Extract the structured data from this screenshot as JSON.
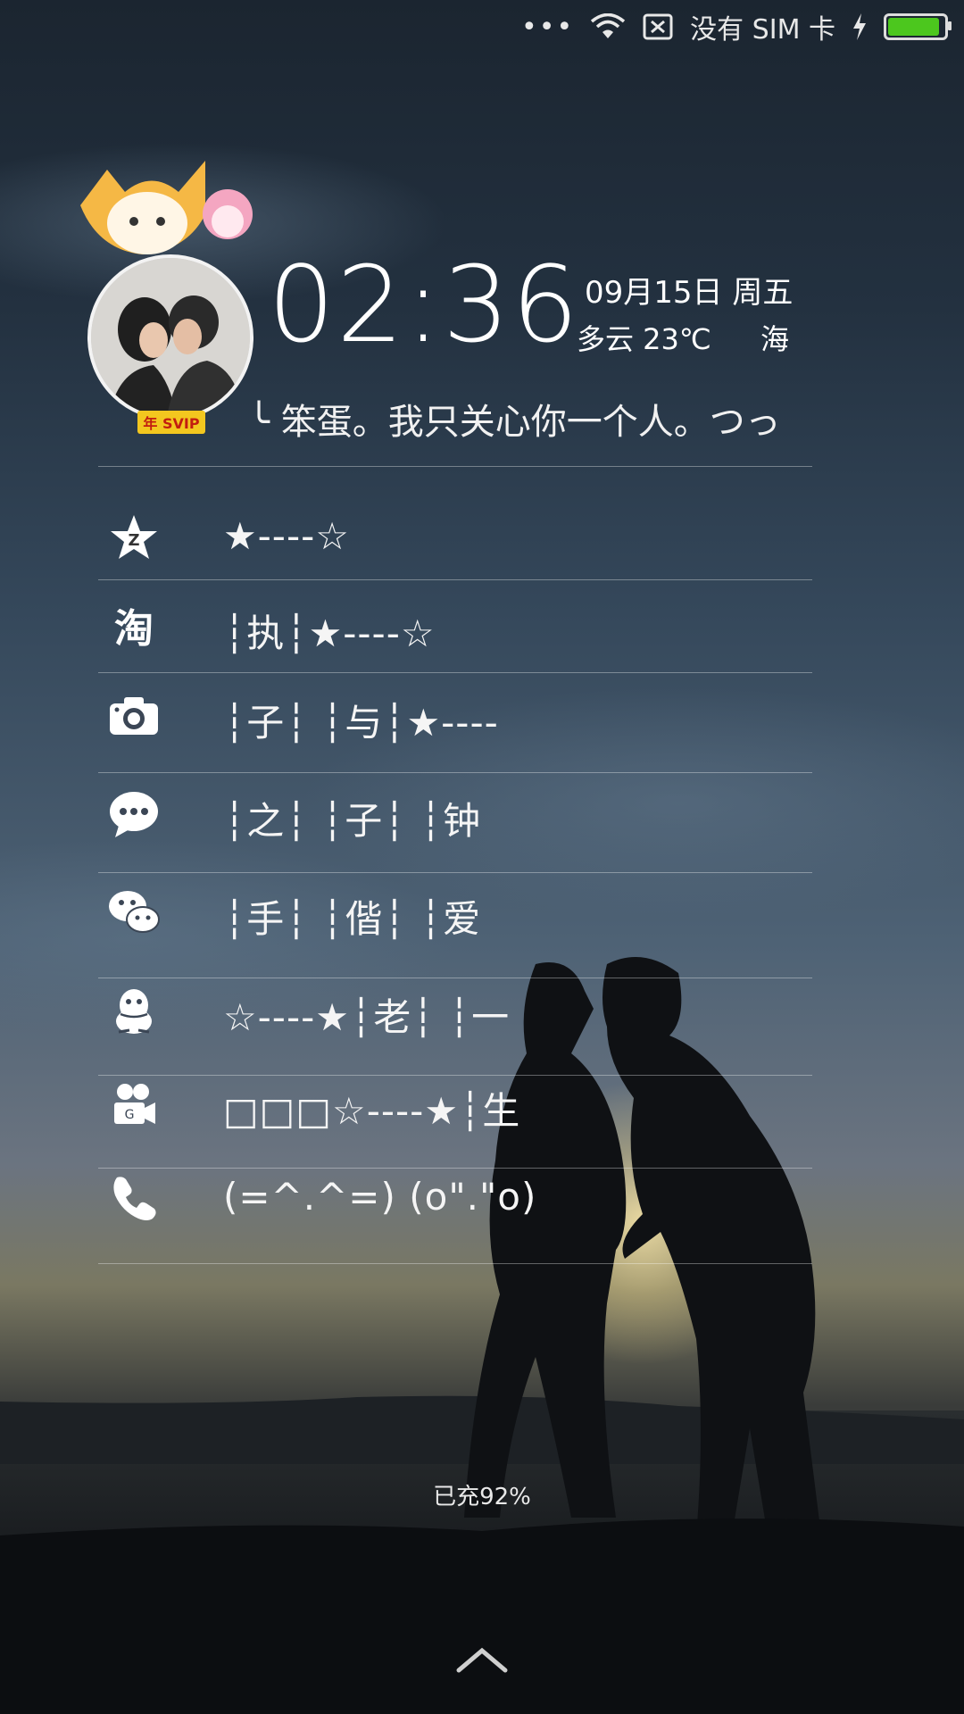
{
  "status_bar": {
    "dots": "•••",
    "sim_text": "没有 SIM 卡",
    "battery_level": 92
  },
  "avatar": {
    "vip_badge": "年 SVIP"
  },
  "clock": {
    "time": "02:36",
    "date": "09月15日 周五",
    "weather": "多云 23℃",
    "region": "海"
  },
  "motto": "╰ 笨蛋。我只关心你一个人。つっ",
  "shortcuts": [
    {
      "app_icon": "qzone-star-icon",
      "label": "★----☆"
    },
    {
      "app_icon": "taobao-icon",
      "label": "┆执┆★----☆"
    },
    {
      "app_icon": "camera-icon",
      "label": "┆子┆ ┆与┆★----"
    },
    {
      "app_icon": "messages-icon",
      "label": "┆之┆ ┆子┆ ┆钟"
    },
    {
      "app_icon": "wechat-icon",
      "label": "┆手┆ ┆偕┆ ┆爱"
    },
    {
      "app_icon": "qq-penguin-icon",
      "label": "☆----★┆老┆ ┆一"
    },
    {
      "app_icon": "video-camera-icon",
      "label": "□□□☆----★┆生"
    },
    {
      "app_icon": "phone-icon",
      "label": "(=^.^=) (o\".\"o)"
    }
  ],
  "charging_text": "已充92%",
  "colors": {
    "battery_fill": "#4cc71e",
    "vip_badge_bg": "#f3c71f"
  }
}
